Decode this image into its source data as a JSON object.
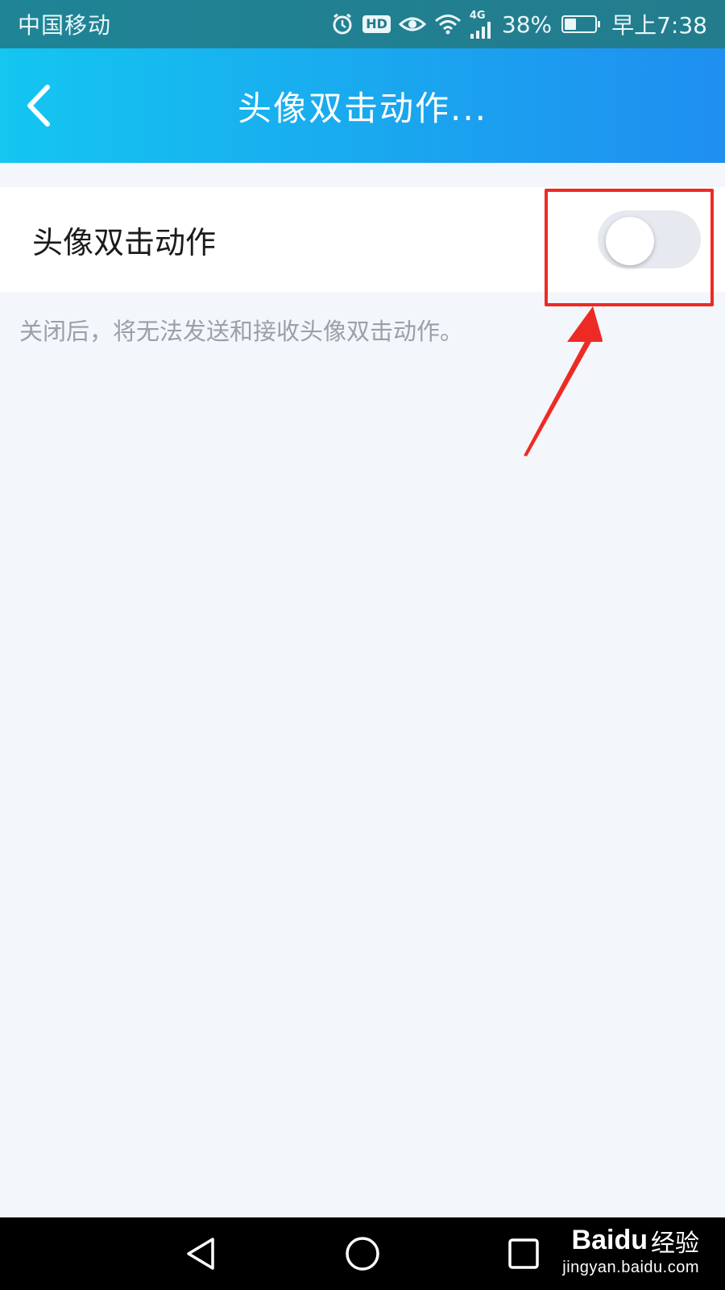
{
  "status_bar": {
    "carrier": "中国移动",
    "hd_badge": "HD",
    "network": "4G",
    "battery": "38%",
    "battery_level": 0.38,
    "time": "早上7:38",
    "icons": [
      "alarm-icon",
      "hd-icon",
      "eye-icon",
      "wifi-icon",
      "signal-icon",
      "battery-icon"
    ]
  },
  "header": {
    "title": "头像双击动作..."
  },
  "setting": {
    "label": "头像双击动作",
    "enabled": false,
    "hint": "关闭后，将无法发送和接收头像双击动作。"
  },
  "annotation": {
    "color": "#ee2a24"
  },
  "nav_bar": {
    "buttons": [
      "back-triangle",
      "home-circle",
      "recents-square"
    ]
  },
  "watermark": {
    "brand": "Baidu",
    "cn": "经验",
    "url": "jingyan.baidu.com"
  },
  "colors": {
    "header_gradient": [
      "#14c6f0",
      "#1f8ff0"
    ],
    "status_bar": "#20828f",
    "background": "#f3f6fa",
    "toggle_off": "#e6e9ef"
  }
}
